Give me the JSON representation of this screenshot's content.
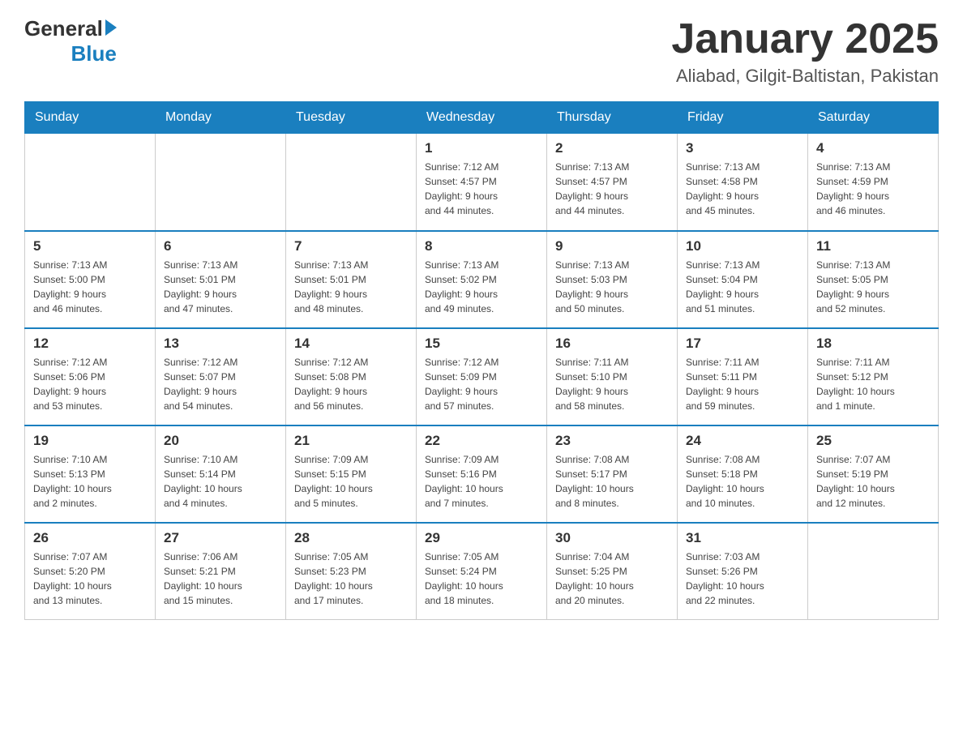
{
  "header": {
    "logo_general": "General",
    "logo_blue": "Blue",
    "month_title": "January 2025",
    "location": "Aliabad, Gilgit-Baltistan, Pakistan"
  },
  "days_of_week": [
    "Sunday",
    "Monday",
    "Tuesday",
    "Wednesday",
    "Thursday",
    "Friday",
    "Saturday"
  ],
  "weeks": [
    [
      {
        "day": "",
        "info": ""
      },
      {
        "day": "",
        "info": ""
      },
      {
        "day": "",
        "info": ""
      },
      {
        "day": "1",
        "info": "Sunrise: 7:12 AM\nSunset: 4:57 PM\nDaylight: 9 hours\nand 44 minutes."
      },
      {
        "day": "2",
        "info": "Sunrise: 7:13 AM\nSunset: 4:57 PM\nDaylight: 9 hours\nand 44 minutes."
      },
      {
        "day": "3",
        "info": "Sunrise: 7:13 AM\nSunset: 4:58 PM\nDaylight: 9 hours\nand 45 minutes."
      },
      {
        "day": "4",
        "info": "Sunrise: 7:13 AM\nSunset: 4:59 PM\nDaylight: 9 hours\nand 46 minutes."
      }
    ],
    [
      {
        "day": "5",
        "info": "Sunrise: 7:13 AM\nSunset: 5:00 PM\nDaylight: 9 hours\nand 46 minutes."
      },
      {
        "day": "6",
        "info": "Sunrise: 7:13 AM\nSunset: 5:01 PM\nDaylight: 9 hours\nand 47 minutes."
      },
      {
        "day": "7",
        "info": "Sunrise: 7:13 AM\nSunset: 5:01 PM\nDaylight: 9 hours\nand 48 minutes."
      },
      {
        "day": "8",
        "info": "Sunrise: 7:13 AM\nSunset: 5:02 PM\nDaylight: 9 hours\nand 49 minutes."
      },
      {
        "day": "9",
        "info": "Sunrise: 7:13 AM\nSunset: 5:03 PM\nDaylight: 9 hours\nand 50 minutes."
      },
      {
        "day": "10",
        "info": "Sunrise: 7:13 AM\nSunset: 5:04 PM\nDaylight: 9 hours\nand 51 minutes."
      },
      {
        "day": "11",
        "info": "Sunrise: 7:13 AM\nSunset: 5:05 PM\nDaylight: 9 hours\nand 52 minutes."
      }
    ],
    [
      {
        "day": "12",
        "info": "Sunrise: 7:12 AM\nSunset: 5:06 PM\nDaylight: 9 hours\nand 53 minutes."
      },
      {
        "day": "13",
        "info": "Sunrise: 7:12 AM\nSunset: 5:07 PM\nDaylight: 9 hours\nand 54 minutes."
      },
      {
        "day": "14",
        "info": "Sunrise: 7:12 AM\nSunset: 5:08 PM\nDaylight: 9 hours\nand 56 minutes."
      },
      {
        "day": "15",
        "info": "Sunrise: 7:12 AM\nSunset: 5:09 PM\nDaylight: 9 hours\nand 57 minutes."
      },
      {
        "day": "16",
        "info": "Sunrise: 7:11 AM\nSunset: 5:10 PM\nDaylight: 9 hours\nand 58 minutes."
      },
      {
        "day": "17",
        "info": "Sunrise: 7:11 AM\nSunset: 5:11 PM\nDaylight: 9 hours\nand 59 minutes."
      },
      {
        "day": "18",
        "info": "Sunrise: 7:11 AM\nSunset: 5:12 PM\nDaylight: 10 hours\nand 1 minute."
      }
    ],
    [
      {
        "day": "19",
        "info": "Sunrise: 7:10 AM\nSunset: 5:13 PM\nDaylight: 10 hours\nand 2 minutes."
      },
      {
        "day": "20",
        "info": "Sunrise: 7:10 AM\nSunset: 5:14 PM\nDaylight: 10 hours\nand 4 minutes."
      },
      {
        "day": "21",
        "info": "Sunrise: 7:09 AM\nSunset: 5:15 PM\nDaylight: 10 hours\nand 5 minutes."
      },
      {
        "day": "22",
        "info": "Sunrise: 7:09 AM\nSunset: 5:16 PM\nDaylight: 10 hours\nand 7 minutes."
      },
      {
        "day": "23",
        "info": "Sunrise: 7:08 AM\nSunset: 5:17 PM\nDaylight: 10 hours\nand 8 minutes."
      },
      {
        "day": "24",
        "info": "Sunrise: 7:08 AM\nSunset: 5:18 PM\nDaylight: 10 hours\nand 10 minutes."
      },
      {
        "day": "25",
        "info": "Sunrise: 7:07 AM\nSunset: 5:19 PM\nDaylight: 10 hours\nand 12 minutes."
      }
    ],
    [
      {
        "day": "26",
        "info": "Sunrise: 7:07 AM\nSunset: 5:20 PM\nDaylight: 10 hours\nand 13 minutes."
      },
      {
        "day": "27",
        "info": "Sunrise: 7:06 AM\nSunset: 5:21 PM\nDaylight: 10 hours\nand 15 minutes."
      },
      {
        "day": "28",
        "info": "Sunrise: 7:05 AM\nSunset: 5:23 PM\nDaylight: 10 hours\nand 17 minutes."
      },
      {
        "day": "29",
        "info": "Sunrise: 7:05 AM\nSunset: 5:24 PM\nDaylight: 10 hours\nand 18 minutes."
      },
      {
        "day": "30",
        "info": "Sunrise: 7:04 AM\nSunset: 5:25 PM\nDaylight: 10 hours\nand 20 minutes."
      },
      {
        "day": "31",
        "info": "Sunrise: 7:03 AM\nSunset: 5:26 PM\nDaylight: 10 hours\nand 22 minutes."
      },
      {
        "day": "",
        "info": ""
      }
    ]
  ]
}
